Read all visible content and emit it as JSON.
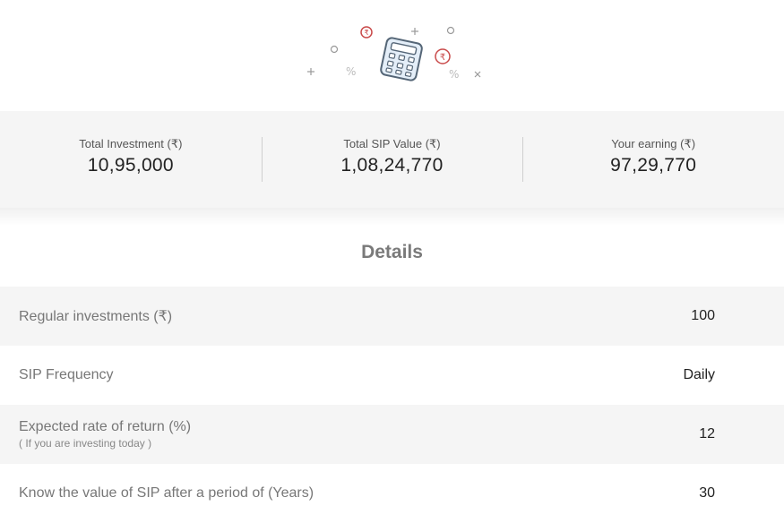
{
  "hero": {
    "illustration": "calculator-icon",
    "currency_glyph": "₹"
  },
  "summary": {
    "total_investment": {
      "label": "Total Investment (₹)",
      "value": "10,95,000"
    },
    "total_sip_value": {
      "label": "Total SIP Value (₹)",
      "value": "1,08,24,770"
    },
    "your_earning": {
      "label": "Your earning (₹)",
      "value": "97,29,770"
    }
  },
  "details": {
    "title": "Details",
    "rows": [
      {
        "label": "Regular investments (₹)",
        "value": "100"
      },
      {
        "label": "SIP Frequency",
        "value": "Daily"
      },
      {
        "label": "Expected rate of return (%)",
        "sublabel": "( If you are investing today )",
        "value": "12"
      },
      {
        "label": "Know the value of SIP after a period of (Years)",
        "value": "30"
      }
    ]
  },
  "colors": {
    "accent_red": "#c94a4a",
    "icon_blue": "#7fa6c9",
    "panel_bg": "#f5f5f5"
  }
}
